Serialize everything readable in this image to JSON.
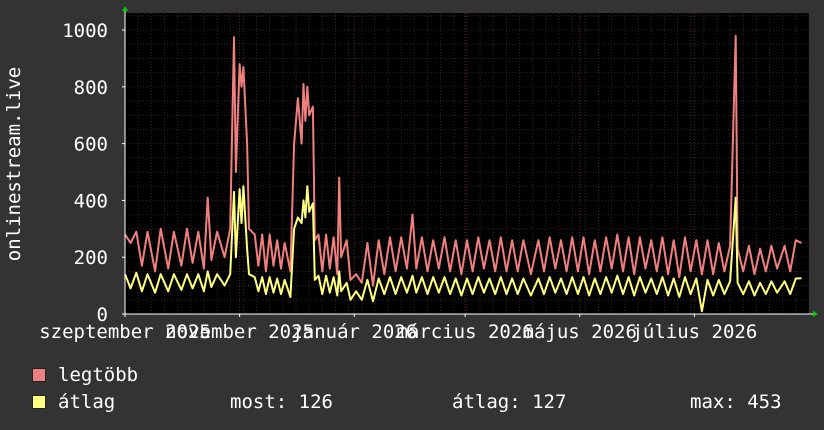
{
  "colors": {
    "background": "#333333",
    "plot_bg": "#000000",
    "grid": "#3a2222",
    "axis": "#ffffff",
    "arrow": "#00cc00",
    "max_series": "#f08080",
    "avg_series": "#ffff80"
  },
  "legend": {
    "max_label": "legtöbb",
    "avg_label": "átlag",
    "now": "most: 126",
    "avg": "átlag: 127",
    "max": "max: 453"
  },
  "chart_data": {
    "type": "line",
    "ylabel": "onlinestream.live",
    "ylim": [
      0,
      1060
    ],
    "yticks": [
      0,
      200,
      400,
      600,
      800,
      1000
    ],
    "xlim": [
      "2025-09-01",
      "2026-08-31"
    ],
    "xticks": [
      {
        "label": "szeptember 2025",
        "date": "2025-09-01"
      },
      {
        "label": "november 2025",
        "date": "2025-11-01"
      },
      {
        "label": "január 2026",
        "date": "2026-01-01"
      },
      {
        "label": "március 2026",
        "date": "2026-03-01"
      },
      {
        "label": "május 2026",
        "date": "2026-05-01"
      },
      {
        "label": "július 2026",
        "date": "2026-07-01"
      }
    ],
    "series": [
      {
        "name": "legtöbb",
        "points": [
          [
            "2025-09-01",
            280
          ],
          [
            "2025-09-04",
            250
          ],
          [
            "2025-09-07",
            290
          ],
          [
            "2025-09-10",
            170
          ],
          [
            "2025-09-13",
            290
          ],
          [
            "2025-09-17",
            150
          ],
          [
            "2025-09-20",
            300
          ],
          [
            "2025-09-24",
            160
          ],
          [
            "2025-09-27",
            290
          ],
          [
            "2025-10-01",
            170
          ],
          [
            "2025-10-04",
            300
          ],
          [
            "2025-10-07",
            180
          ],
          [
            "2025-10-10",
            290
          ],
          [
            "2025-10-13",
            160
          ],
          [
            "2025-10-15",
            410
          ],
          [
            "2025-10-17",
            190
          ],
          [
            "2025-10-20",
            290
          ],
          [
            "2025-10-24",
            200
          ],
          [
            "2025-10-27",
            300
          ],
          [
            "2025-10-29",
            975
          ],
          [
            "2025-10-30",
            500
          ],
          [
            "2025-11-01",
            880
          ],
          [
            "2025-11-02",
            800
          ],
          [
            "2025-11-03",
            870
          ],
          [
            "2025-11-05",
            600
          ],
          [
            "2025-11-06",
            300
          ],
          [
            "2025-11-09",
            280
          ],
          [
            "2025-11-11",
            170
          ],
          [
            "2025-11-13",
            280
          ],
          [
            "2025-11-15",
            150
          ],
          [
            "2025-11-17",
            280
          ],
          [
            "2025-11-19",
            170
          ],
          [
            "2025-11-21",
            260
          ],
          [
            "2025-11-23",
            160
          ],
          [
            "2025-11-25",
            250
          ],
          [
            "2025-11-28",
            150
          ],
          [
            "2025-11-30",
            600
          ],
          [
            "2025-12-02",
            760
          ],
          [
            "2025-12-04",
            600
          ],
          [
            "2025-12-05",
            810
          ],
          [
            "2025-12-06",
            680
          ],
          [
            "2025-12-07",
            800
          ],
          [
            "2025-12-08",
            700
          ],
          [
            "2025-12-10",
            730
          ],
          [
            "2025-12-11",
            260
          ],
          [
            "2025-12-13",
            280
          ],
          [
            "2025-12-15",
            150
          ],
          [
            "2025-12-17",
            280
          ],
          [
            "2025-12-19",
            160
          ],
          [
            "2025-12-21",
            270
          ],
          [
            "2025-12-23",
            140
          ],
          [
            "2025-12-24",
            480
          ],
          [
            "2025-12-25",
            200
          ],
          [
            "2025-12-28",
            260
          ],
          [
            "2025-12-30",
            120
          ],
          [
            "2026-01-02",
            140
          ],
          [
            "2026-01-05",
            110
          ],
          [
            "2026-01-08",
            250
          ],
          [
            "2026-01-11",
            100
          ],
          [
            "2026-01-14",
            260
          ],
          [
            "2026-01-17",
            140
          ],
          [
            "2026-01-20",
            270
          ],
          [
            "2026-01-23",
            150
          ],
          [
            "2026-01-26",
            270
          ],
          [
            "2026-01-29",
            160
          ],
          [
            "2026-02-01",
            350
          ],
          [
            "2026-02-03",
            160
          ],
          [
            "2026-02-06",
            270
          ],
          [
            "2026-02-09",
            150
          ],
          [
            "2026-02-12",
            260
          ],
          [
            "2026-02-15",
            160
          ],
          [
            "2026-02-18",
            270
          ],
          [
            "2026-02-21",
            150
          ],
          [
            "2026-02-24",
            260
          ],
          [
            "2026-02-27",
            140
          ],
          [
            "2026-03-02",
            260
          ],
          [
            "2026-03-05",
            150
          ],
          [
            "2026-03-08",
            270
          ],
          [
            "2026-03-11",
            160
          ],
          [
            "2026-03-14",
            260
          ],
          [
            "2026-03-17",
            150
          ],
          [
            "2026-03-20",
            270
          ],
          [
            "2026-03-23",
            150
          ],
          [
            "2026-03-26",
            260
          ],
          [
            "2026-03-29",
            150
          ],
          [
            "2026-04-01",
            260
          ],
          [
            "2026-04-05",
            140
          ],
          [
            "2026-04-09",
            260
          ],
          [
            "2026-04-12",
            150
          ],
          [
            "2026-04-15",
            270
          ],
          [
            "2026-04-18",
            160
          ],
          [
            "2026-04-21",
            260
          ],
          [
            "2026-04-24",
            150
          ],
          [
            "2026-04-27",
            270
          ],
          [
            "2026-04-30",
            150
          ],
          [
            "2026-05-03",
            270
          ],
          [
            "2026-05-06",
            140
          ],
          [
            "2026-05-09",
            260
          ],
          [
            "2026-05-12",
            150
          ],
          [
            "2026-05-15",
            270
          ],
          [
            "2026-05-18",
            160
          ],
          [
            "2026-05-21",
            280
          ],
          [
            "2026-05-24",
            150
          ],
          [
            "2026-05-27",
            270
          ],
          [
            "2026-05-30",
            140
          ],
          [
            "2026-06-02",
            270
          ],
          [
            "2026-06-05",
            160
          ],
          [
            "2026-06-08",
            260
          ],
          [
            "2026-06-11",
            150
          ],
          [
            "2026-06-14",
            270
          ],
          [
            "2026-06-17",
            140
          ],
          [
            "2026-06-20",
            260
          ],
          [
            "2026-06-23",
            130
          ],
          [
            "2026-06-26",
            270
          ],
          [
            "2026-06-29",
            150
          ],
          [
            "2026-07-02",
            260
          ],
          [
            "2026-07-05",
            140
          ],
          [
            "2026-07-08",
            260
          ],
          [
            "2026-07-11",
            140
          ],
          [
            "2026-07-14",
            250
          ],
          [
            "2026-07-17",
            150
          ],
          [
            "2026-07-20",
            240
          ],
          [
            "2026-07-23",
            980
          ],
          [
            "2026-07-24",
            230
          ],
          [
            "2026-07-27",
            150
          ],
          [
            "2026-07-30",
            240
          ],
          [
            "2026-08-02",
            140
          ],
          [
            "2026-08-05",
            230
          ],
          [
            "2026-08-08",
            150
          ],
          [
            "2026-08-11",
            240
          ],
          [
            "2026-08-14",
            160
          ],
          [
            "2026-08-18",
            240
          ],
          [
            "2026-08-21",
            150
          ],
          [
            "2026-08-24",
            260
          ],
          [
            "2026-08-27",
            250
          ]
        ]
      },
      {
        "name": "átlag",
        "points": [
          [
            "2025-09-01",
            140
          ],
          [
            "2025-09-04",
            90
          ],
          [
            "2025-09-07",
            145
          ],
          [
            "2025-09-10",
            80
          ],
          [
            "2025-09-13",
            140
          ],
          [
            "2025-09-17",
            75
          ],
          [
            "2025-09-20",
            140
          ],
          [
            "2025-09-24",
            80
          ],
          [
            "2025-09-27",
            140
          ],
          [
            "2025-10-01",
            85
          ],
          [
            "2025-10-04",
            140
          ],
          [
            "2025-10-07",
            90
          ],
          [
            "2025-10-10",
            140
          ],
          [
            "2025-10-13",
            80
          ],
          [
            "2025-10-15",
            150
          ],
          [
            "2025-10-17",
            95
          ],
          [
            "2025-10-20",
            140
          ],
          [
            "2025-10-24",
            100
          ],
          [
            "2025-10-27",
            140
          ],
          [
            "2025-10-29",
            430
          ],
          [
            "2025-10-30",
            200
          ],
          [
            "2025-11-01",
            440
          ],
          [
            "2025-11-02",
            320
          ],
          [
            "2025-11-03",
            450
          ],
          [
            "2025-11-05",
            230
          ],
          [
            "2025-11-06",
            140
          ],
          [
            "2025-11-09",
            130
          ],
          [
            "2025-11-11",
            80
          ],
          [
            "2025-11-13",
            130
          ],
          [
            "2025-11-15",
            70
          ],
          [
            "2025-11-17",
            130
          ],
          [
            "2025-11-19",
            75
          ],
          [
            "2025-11-21",
            125
          ],
          [
            "2025-11-23",
            70
          ],
          [
            "2025-11-25",
            120
          ],
          [
            "2025-11-28",
            60
          ],
          [
            "2025-11-30",
            300
          ],
          [
            "2025-12-02",
            340
          ],
          [
            "2025-12-04",
            320
          ],
          [
            "2025-12-05",
            400
          ],
          [
            "2025-12-06",
            340
          ],
          [
            "2025-12-07",
            450
          ],
          [
            "2025-12-08",
            360
          ],
          [
            "2025-12-10",
            390
          ],
          [
            "2025-12-11",
            120
          ],
          [
            "2025-12-13",
            135
          ],
          [
            "2025-12-15",
            70
          ],
          [
            "2025-12-17",
            135
          ],
          [
            "2025-12-19",
            75
          ],
          [
            "2025-12-21",
            130
          ],
          [
            "2025-12-23",
            65
          ],
          [
            "2025-12-24",
            150
          ],
          [
            "2025-12-25",
            80
          ],
          [
            "2025-12-28",
            110
          ],
          [
            "2025-12-30",
            50
          ],
          [
            "2026-01-02",
            80
          ],
          [
            "2026-01-05",
            50
          ],
          [
            "2026-01-08",
            120
          ],
          [
            "2026-01-11",
            45
          ],
          [
            "2026-01-14",
            125
          ],
          [
            "2026-01-17",
            70
          ],
          [
            "2026-01-20",
            130
          ],
          [
            "2026-01-23",
            70
          ],
          [
            "2026-01-26",
            130
          ],
          [
            "2026-01-29",
            75
          ],
          [
            "2026-02-01",
            135
          ],
          [
            "2026-02-03",
            75
          ],
          [
            "2026-02-06",
            130
          ],
          [
            "2026-02-09",
            70
          ],
          [
            "2026-02-12",
            130
          ],
          [
            "2026-02-15",
            75
          ],
          [
            "2026-02-18",
            130
          ],
          [
            "2026-02-21",
            70
          ],
          [
            "2026-02-24",
            125
          ],
          [
            "2026-02-27",
            65
          ],
          [
            "2026-03-02",
            125
          ],
          [
            "2026-03-05",
            70
          ],
          [
            "2026-03-08",
            130
          ],
          [
            "2026-03-11",
            75
          ],
          [
            "2026-03-14",
            125
          ],
          [
            "2026-03-17",
            70
          ],
          [
            "2026-03-20",
            130
          ],
          [
            "2026-03-23",
            70
          ],
          [
            "2026-03-26",
            125
          ],
          [
            "2026-03-29",
            70
          ],
          [
            "2026-04-01",
            125
          ],
          [
            "2026-04-05",
            65
          ],
          [
            "2026-04-09",
            125
          ],
          [
            "2026-04-12",
            70
          ],
          [
            "2026-04-15",
            130
          ],
          [
            "2026-04-18",
            75
          ],
          [
            "2026-04-21",
            125
          ],
          [
            "2026-04-24",
            70
          ],
          [
            "2026-04-27",
            130
          ],
          [
            "2026-04-30",
            70
          ],
          [
            "2026-05-03",
            130
          ],
          [
            "2026-05-06",
            65
          ],
          [
            "2026-05-09",
            125
          ],
          [
            "2026-05-12",
            70
          ],
          [
            "2026-05-15",
            130
          ],
          [
            "2026-05-18",
            75
          ],
          [
            "2026-05-21",
            135
          ],
          [
            "2026-05-24",
            70
          ],
          [
            "2026-05-27",
            130
          ],
          [
            "2026-05-30",
            65
          ],
          [
            "2026-06-02",
            130
          ],
          [
            "2026-06-05",
            75
          ],
          [
            "2026-06-08",
            125
          ],
          [
            "2026-06-11",
            70
          ],
          [
            "2026-06-14",
            130
          ],
          [
            "2026-06-17",
            65
          ],
          [
            "2026-06-20",
            125
          ],
          [
            "2026-06-23",
            60
          ],
          [
            "2026-06-26",
            130
          ],
          [
            "2026-06-29",
            70
          ],
          [
            "2026-07-02",
            125
          ],
          [
            "2026-07-05",
            10
          ],
          [
            "2026-07-08",
            120
          ],
          [
            "2026-07-11",
            65
          ],
          [
            "2026-07-14",
            120
          ],
          [
            "2026-07-17",
            70
          ],
          [
            "2026-07-20",
            115
          ],
          [
            "2026-07-23",
            410
          ],
          [
            "2026-07-24",
            110
          ],
          [
            "2026-07-27",
            70
          ],
          [
            "2026-07-30",
            115
          ],
          [
            "2026-08-02",
            65
          ],
          [
            "2026-08-05",
            110
          ],
          [
            "2026-08-08",
            70
          ],
          [
            "2026-08-11",
            115
          ],
          [
            "2026-08-14",
            75
          ],
          [
            "2026-08-18",
            115
          ],
          [
            "2026-08-21",
            70
          ],
          [
            "2026-08-24",
            125
          ],
          [
            "2026-08-27",
            126
          ]
        ]
      }
    ]
  }
}
